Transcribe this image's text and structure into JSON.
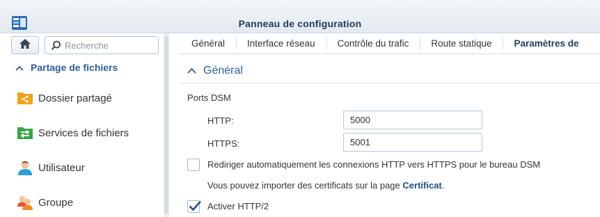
{
  "window": {
    "title": "Panneau de configuration"
  },
  "sidebar": {
    "search_placeholder": "Recherche",
    "section_label": "Partage de fichiers",
    "items": [
      {
        "label": "Dossier partagé",
        "icon": "shared-folder-icon"
      },
      {
        "label": "Services de fichiers",
        "icon": "file-services-icon"
      },
      {
        "label": "Utilisateur",
        "icon": "user-icon"
      },
      {
        "label": "Groupe",
        "icon": "group-icon"
      }
    ]
  },
  "tabs": [
    "Général",
    "Interface réseau",
    "Contrôle du trafic",
    "Route statique",
    "Paramètres de"
  ],
  "active_tab": "Paramètres de",
  "main": {
    "section_title": "Général",
    "ports_label": "Ports DSM",
    "http_label": "HTTP:",
    "http_value": "5000",
    "https_label": "HTTPS:",
    "https_value": "5001",
    "redirect_label": "Rediriger automatiquement les connexions HTTP vers HTTPS pour le bureau DSM",
    "redirect_checked": false,
    "cert_text": "Vous pouvez importer des certificats sur la page",
    "cert_link": "Certificat",
    "cert_period": ".",
    "http2_label": "Activer HTTP/2",
    "http2_checked": true
  },
  "colors": {
    "accent": "#2e5d97",
    "title": "#1f3a5a",
    "link": "#1f4e86"
  }
}
